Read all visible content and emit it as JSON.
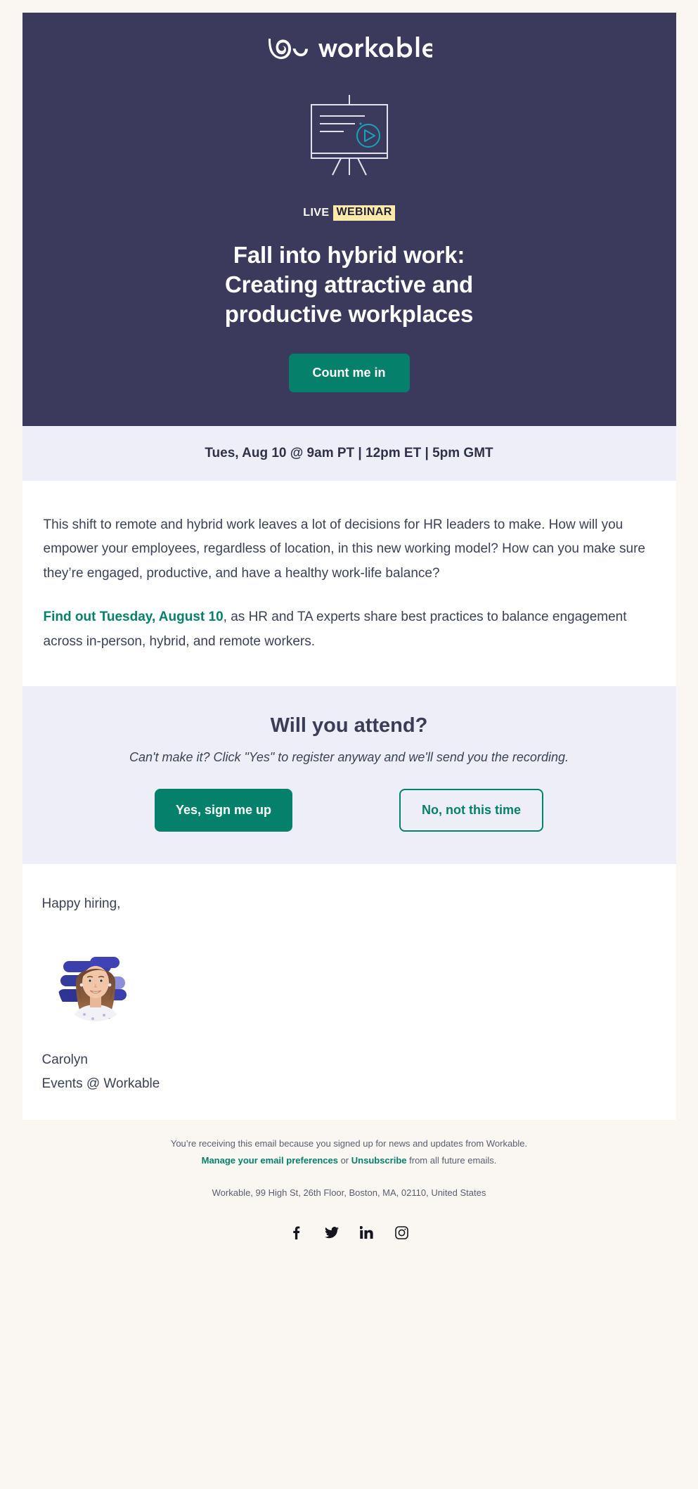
{
  "brand": {
    "logo_text": "workable",
    "logo_icon": "workable-wordmark",
    "navy": "#3b3a5c",
    "teal": "#04806b",
    "accent_yellow": "#fde9a8",
    "lavender": "#eeeef8",
    "page_bg": "#faf6f2"
  },
  "hero": {
    "illustration_icon": "webinar-presentation-board-icon",
    "badge_live": "LIVE",
    "badge_webinar": "WEBINAR",
    "title_lines": [
      "Fall into hybrid work:",
      "Creating attractive and",
      "productive workplaces"
    ],
    "title": "Fall into hybrid work: Creating attractive and productive workplaces",
    "cta_label": "Count me in"
  },
  "date_bar": {
    "text": "Tues, Aug 10 @ 9am PT | 12pm ET | 5pm GMT"
  },
  "body": {
    "paragraph_1": "This shift to remote and hybrid work leaves a lot of decisions for HR leaders to make. How will you empower your employees, regardless of location, in this new working model? How can you make sure they’re engaged, productive, and have a healthy work-life balance?",
    "paragraph_2_link": "Find out Tuesday, August 10",
    "paragraph_2_rest": ", as HR and TA experts share best practices to balance engagement across in-person, hybrid, and remote workers."
  },
  "attend": {
    "title": "Will you attend?",
    "subtitle": "Can't make it? Click \"Yes\" to register anyway and we'll send you the recording.",
    "yes_label": "Yes, sign me up",
    "no_label": "No, not this time"
  },
  "signature": {
    "greeting": "Happy hiring,",
    "avatar_icon": "carolyn-avatar-photo",
    "name": "Carolyn",
    "role": "Events @ Workable"
  },
  "footer": {
    "line_1": "You’re receiving this email because you signed up for news and updates from Workable.",
    "manage_link": "Manage your email preferences",
    "or_text": " or ",
    "unsubscribe_link": "Unsubscribe",
    "line_2_rest": " from all future emails.",
    "address": "Workable, 99 High St, 26th Floor, Boston, MA, 02110, United States",
    "social": [
      {
        "name": "facebook-icon",
        "label": "Facebook"
      },
      {
        "name": "twitter-icon",
        "label": "Twitter"
      },
      {
        "name": "linkedin-icon",
        "label": "LinkedIn"
      },
      {
        "name": "instagram-icon",
        "label": "Instagram"
      }
    ]
  }
}
